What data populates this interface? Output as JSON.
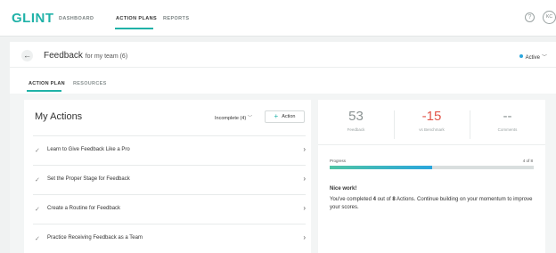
{
  "nav": {
    "logo": "GLINT",
    "items": [
      "DASHBOARD",
      "ACTION PLANS",
      "REPORTS"
    ],
    "active_index": 1,
    "help_icon": "?",
    "avatar_initials": "KC"
  },
  "header": {
    "back_icon": "←",
    "title": "Feedback",
    "title_suffix": "for my team (6)",
    "status_label": "Active",
    "status_chevron": "﹀"
  },
  "tabs": [
    "ACTION PLAN",
    "RESOURCES"
  ],
  "my_actions": {
    "title": "My Actions",
    "filter_label": "Incomplete (4)",
    "filter_chevron": "﹀",
    "add_label": "Action",
    "add_icon": "+",
    "check_icon": "✓",
    "arrow_icon": "›",
    "items": [
      "Learn to Give Feedback Like a Pro",
      "Set the Proper Stage for Feedback",
      "Create a Routine for Feedback",
      "Practice Receiving Feedback as a Team"
    ]
  },
  "stats": [
    {
      "value": "53",
      "label": "Feedback"
    },
    {
      "value": "-15",
      "label": "vs Benchmark"
    },
    {
      "value": "--",
      "label": "Comments"
    }
  ],
  "progress": {
    "label": "Progress",
    "count_text": "4 of 8",
    "fraction": 0.5
  },
  "message": {
    "heading": "Nice work!",
    "body_pre": "You've completed ",
    "completed": "4",
    "body_mid": " out of ",
    "total": "8",
    "body_post": " Actions. Continue building on your momentum to improve your scores."
  },
  "colors": {
    "accent": "#20b2a8",
    "negative": "#e2564a",
    "status_dot": "#2aa6dd"
  }
}
